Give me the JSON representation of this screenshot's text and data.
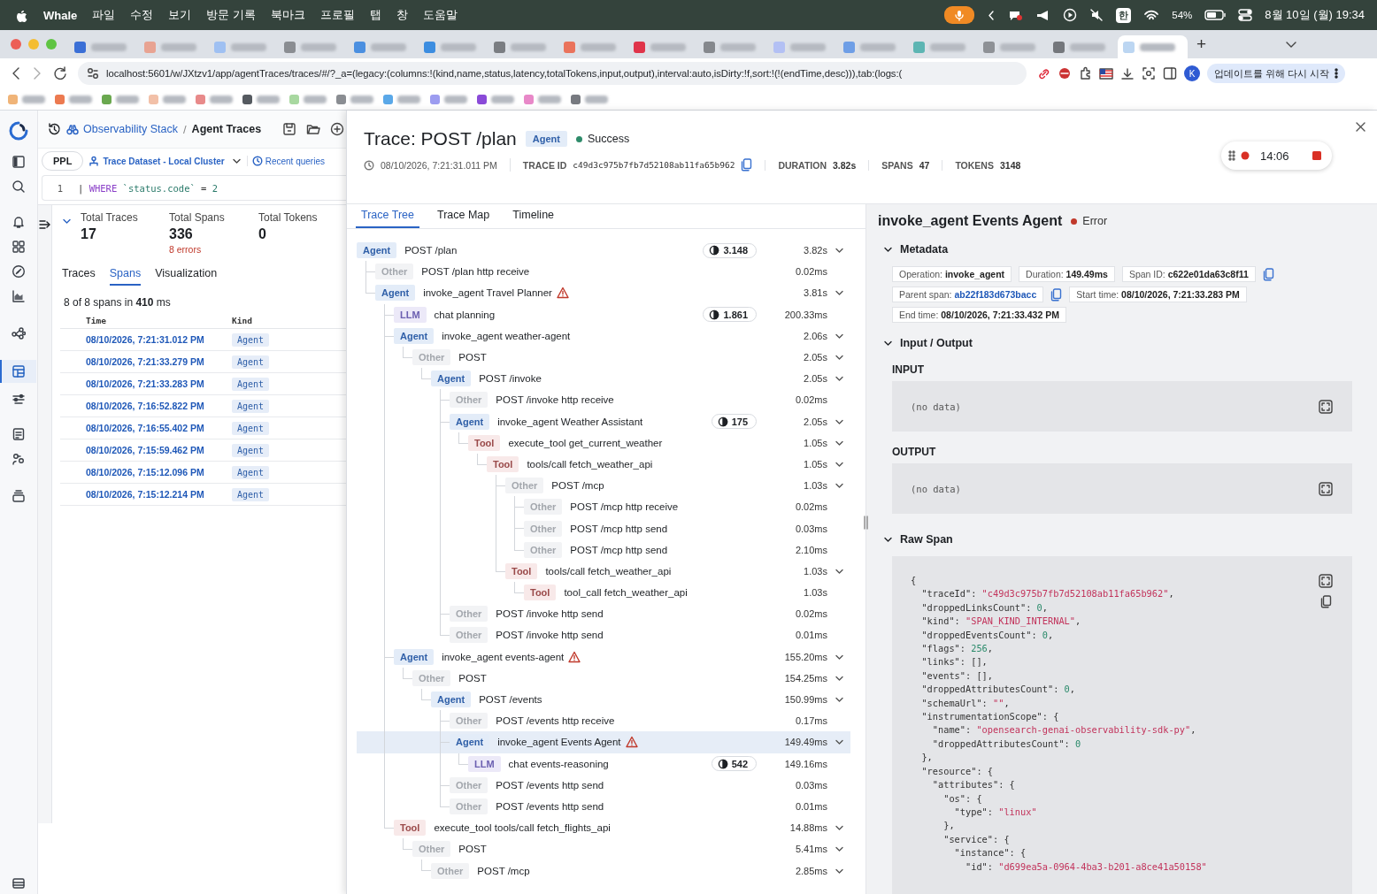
{
  "menubar": {
    "app": "Whale",
    "menus": [
      "파일",
      "수정",
      "보기",
      "방문 기록",
      "북마크",
      "프로필",
      "탭",
      "창",
      "도움말"
    ],
    "input_source": "한",
    "battery": "54%",
    "clock": "8월 10일 (월) 19:34"
  },
  "browser": {
    "tabs": [
      {
        "color": "#3b6fd6",
        "selected": false
      },
      {
        "color": "#e8a392",
        "selected": false
      },
      {
        "color": "#9fc0f2",
        "selected": false
      },
      {
        "color": "#8a8d92",
        "selected": false
      },
      {
        "color": "#4b8fe0",
        "selected": false
      },
      {
        "color": "#3c8de0",
        "selected": false
      },
      {
        "color": "#7a7d82",
        "selected": false
      },
      {
        "color": "#ea735c",
        "selected": false
      },
      {
        "color": "#e0344a",
        "selected": false
      },
      {
        "color": "#85888d",
        "selected": false
      },
      {
        "color": "#b3c0f4",
        "selected": false
      },
      {
        "color": "#6e9ee6",
        "selected": false
      },
      {
        "color": "#5db5b3",
        "selected": false
      },
      {
        "color": "#8e9196",
        "selected": false
      },
      {
        "color": "#74777c",
        "selected": false
      },
      {
        "color": "#bcd6f2",
        "selected": true
      }
    ],
    "new_tab": "+",
    "url": "localhost:5601/w/JXtzv1/app/agentTraces/traces/#/?_a=(legacy:(columns:!(kind,name,status,latency,totalTokens,input,output),interval:auto,isDirty:!f,sort:!(!(endTime,desc))),tab:(logs:(",
    "profile": "K",
    "update_button": "업데이트를 위해 다시 시작",
    "bookmarks": [
      {
        "color": "#f0b478"
      },
      {
        "color": "#ec7a50"
      },
      {
        "color": "#6aa84f"
      },
      {
        "color": "#f2c0a8"
      },
      {
        "color": "#e88a8a"
      },
      {
        "color": "#555a60"
      },
      {
        "color": "#a8d8a0"
      },
      {
        "color": "#8a8d92"
      },
      {
        "color": "#5aa8e8"
      },
      {
        "color": "#9c9cf0"
      },
      {
        "color": "#8a4ad8"
      },
      {
        "color": "#e888c8"
      },
      {
        "color": "#777a80"
      }
    ]
  },
  "nav": [
    {
      "selected": false
    },
    {
      "selected": false
    },
    {
      "selected": false
    },
    {
      "selected": false
    },
    {
      "selected": false
    },
    {
      "selected": false
    },
    {
      "selected": false
    },
    {
      "selected": true
    },
    {
      "selected": false
    },
    {
      "selected": false
    },
    {
      "selected": false
    },
    {
      "selected": false
    },
    {
      "selected": false
    }
  ],
  "explorer": {
    "breadcrumb": [
      "Observability Stack",
      "Agent Traces"
    ],
    "separator": "/",
    "language": "PPL",
    "dataset": "Trace Dataset - Local Cluster",
    "recent": "Recent queries",
    "query": {
      "line": "1",
      "pipe": "|",
      "keyword": "WHERE",
      "field": "`status.code`",
      "operator": "=",
      "value": "2"
    },
    "stats": [
      {
        "label": "Total Traces",
        "value": "17"
      },
      {
        "label": "Total Spans",
        "value": "336",
        "note": "8 errors"
      },
      {
        "label": "Total Tokens",
        "value": "0"
      }
    ],
    "tabs": [
      {
        "label": "Traces",
        "selected": false
      },
      {
        "label": "Spans",
        "selected": true
      },
      {
        "label": "Visualization",
        "selected": false
      }
    ],
    "summary": "8 of 8 spans in **410** ms",
    "columns": [
      "Time",
      "Kind"
    ],
    "rows": [
      {
        "time": "08/10/2026, 7:21:31.012 PM",
        "kind": "Agent"
      },
      {
        "time": "08/10/2026, 7:21:33.279 PM",
        "kind": "Agent"
      },
      {
        "time": "08/10/2026, 7:21:33.283 PM",
        "kind": "Agent"
      },
      {
        "time": "08/10/2026, 7:16:52.822 PM",
        "kind": "Agent"
      },
      {
        "time": "08/10/2026, 7:16:55.402 PM",
        "kind": "Agent"
      },
      {
        "time": "08/10/2026, 7:15:59.462 PM",
        "kind": "Agent"
      },
      {
        "time": "08/10/2026, 7:15:12.096 PM",
        "kind": "Agent"
      },
      {
        "time": "08/10/2026, 7:15:12.214 PM",
        "kind": "Agent"
      }
    ]
  },
  "trace": {
    "title": "Trace: POST /plan",
    "kind": "Agent",
    "status": {
      "label": "Success",
      "ok": true
    },
    "timestamp": "08/10/2026, 7:21:31.011 PM",
    "meta": [
      {
        "label": "TRACE ID",
        "value": "c49d3c975b7fb7d52108ab11fa65b962",
        "copy": true
      },
      {
        "label": "DURATION",
        "value": "3.82s",
        "copy": false
      },
      {
        "label": "SPANS",
        "value": "47",
        "copy": false
      },
      {
        "label": "TOKENS",
        "value": "3148",
        "copy": false
      }
    ],
    "recorder": {
      "time": "14:06"
    },
    "tabs": [
      {
        "label": "Trace Tree",
        "selected": true
      },
      {
        "label": "Trace Map",
        "selected": false
      },
      {
        "label": "Timeline",
        "selected": false
      }
    ],
    "tree": [
      {
        "kind": "agent",
        "badge": "Agent",
        "name": "POST /plan",
        "tokens": "3.148",
        "duration": "3.82s",
        "error": false,
        "selected": false,
        "expanded": true,
        "children": [
          {
            "kind": "other",
            "badge": "Other",
            "name": "POST /plan http receive",
            "duration": "0.02ms",
            "error": false,
            "selected": false
          },
          {
            "kind": "agent",
            "badge": "Agent",
            "name": "invoke_agent Travel Planner",
            "duration": "3.81s",
            "error": true,
            "selected": false,
            "expanded": true,
            "children": [
              {
                "kind": "llm",
                "badge": "LLM",
                "name": "chat planning",
                "tokens": "1.861",
                "duration": "200.33ms",
                "error": false,
                "selected": false
              },
              {
                "kind": "agent",
                "badge": "Agent",
                "name": "invoke_agent weather-agent",
                "duration": "2.06s",
                "error": false,
                "selected": false,
                "expanded": true,
                "children": [
                  {
                    "kind": "other",
                    "badge": "Other",
                    "name": "POST",
                    "duration": "2.05s",
                    "error": false,
                    "selected": false,
                    "expanded": true,
                    "children": [
                      {
                        "kind": "agent",
                        "badge": "Agent",
                        "name": "POST /invoke",
                        "duration": "2.05s",
                        "error": false,
                        "selected": false,
                        "expanded": true,
                        "children": [
                          {
                            "kind": "other",
                            "badge": "Other",
                            "name": "POST /invoke http receive",
                            "duration": "0.02ms",
                            "error": false,
                            "selected": false
                          },
                          {
                            "kind": "agent",
                            "badge": "Agent",
                            "name": "invoke_agent Weather Assistant",
                            "tokens": "175",
                            "duration": "2.05s",
                            "error": false,
                            "selected": false,
                            "expanded": true,
                            "children": [
                              {
                                "kind": "tool",
                                "badge": "Tool",
                                "name": "execute_tool get_current_weather",
                                "duration": "1.05s",
                                "error": false,
                                "selected": false,
                                "expanded": true,
                                "children": [
                                  {
                                    "kind": "tool",
                                    "badge": "Tool",
                                    "name": "tools/call fetch_weather_api",
                                    "duration": "1.05s",
                                    "error": false,
                                    "selected": false,
                                    "expanded": true,
                                    "children": [
                                      {
                                        "kind": "other",
                                        "badge": "Other",
                                        "name": "POST /mcp",
                                        "duration": "1.03s",
                                        "error": false,
                                        "selected": false,
                                        "expanded": true,
                                        "children": [
                                          {
                                            "kind": "other",
                                            "badge": "Other",
                                            "name": "POST /mcp http receive",
                                            "duration": "0.02ms",
                                            "error": false,
                                            "selected": false
                                          },
                                          {
                                            "kind": "other",
                                            "badge": "Other",
                                            "name": "POST /mcp http send",
                                            "duration": "0.03ms",
                                            "error": false,
                                            "selected": false
                                          },
                                          {
                                            "kind": "other",
                                            "badge": "Other",
                                            "name": "POST /mcp http send",
                                            "duration": "2.10ms",
                                            "error": false,
                                            "selected": false
                                          }
                                        ]
                                      },
                                      {
                                        "kind": "tool",
                                        "badge": "Tool",
                                        "name": "tools/call fetch_weather_api",
                                        "duration": "1.03s",
                                        "error": false,
                                        "selected": false,
                                        "expanded": true,
                                        "children": [
                                          {
                                            "kind": "tool",
                                            "badge": "Tool",
                                            "name": "tool_call fetch_weather_api",
                                            "duration": "1.03s",
                                            "error": false,
                                            "selected": false
                                          }
                                        ]
                                      }
                                    ]
                                  }
                                ]
                              }
                            ]
                          },
                          {
                            "kind": "other",
                            "badge": "Other",
                            "name": "POST /invoke http send",
                            "duration": "0.02ms",
                            "error": false,
                            "selected": false
                          },
                          {
                            "kind": "other",
                            "badge": "Other",
                            "name": "POST /invoke http send",
                            "duration": "0.01ms",
                            "error": false,
                            "selected": false
                          }
                        ]
                      }
                    ]
                  }
                ]
              },
              {
                "kind": "agent",
                "badge": "Agent",
                "name": "invoke_agent events-agent",
                "duration": "155.20ms",
                "error": true,
                "selected": false,
                "expanded": true,
                "children": [
                  {
                    "kind": "other",
                    "badge": "Other",
                    "name": "POST",
                    "duration": "154.25ms",
                    "error": false,
                    "selected": false,
                    "expanded": true,
                    "children": [
                      {
                        "kind": "agent",
                        "badge": "Agent",
                        "name": "POST /events",
                        "duration": "150.99ms",
                        "error": false,
                        "selected": false,
                        "expanded": true,
                        "children": [
                          {
                            "kind": "other",
                            "badge": "Other",
                            "name": "POST /events http receive",
                            "duration": "0.17ms",
                            "error": false,
                            "selected": false
                          },
                          {
                            "kind": "agent",
                            "badge": "Agent",
                            "name": "invoke_agent Events Agent",
                            "duration": "149.49ms",
                            "error": true,
                            "selected": true,
                            "expanded": true,
                            "children": [
                              {
                                "kind": "llm",
                                "badge": "LLM",
                                "name": "chat events-reasoning",
                                "tokens": "542",
                                "duration": "149.16ms",
                                "error": false,
                                "selected": false
                              }
                            ]
                          },
                          {
                            "kind": "other",
                            "badge": "Other",
                            "name": "POST /events http send",
                            "duration": "0.03ms",
                            "error": false,
                            "selected": false
                          },
                          {
                            "kind": "other",
                            "badge": "Other",
                            "name": "POST /events http send",
                            "duration": "0.01ms",
                            "error": false,
                            "selected": false
                          }
                        ]
                      }
                    ]
                  }
                ]
              },
              {
                "kind": "tool",
                "badge": "Tool",
                "name": "execute_tool tools/call fetch_flights_api",
                "duration": "14.88ms",
                "error": false,
                "selected": false,
                "expanded": true,
                "children": [
                  {
                    "kind": "other",
                    "badge": "Other",
                    "name": "POST",
                    "duration": "5.41ms",
                    "error": false,
                    "selected": false,
                    "expanded": true,
                    "children": [
                      {
                        "kind": "other",
                        "badge": "Other",
                        "name": "POST /mcp",
                        "duration": "2.85ms",
                        "error": false,
                        "selected": false,
                        "expanded": true
                      }
                    ]
                  }
                ]
              }
            ]
          }
        ]
      }
    ],
    "detail": {
      "title": "invoke_agent Events Agent",
      "status": {
        "label": "Error",
        "ok": false
      },
      "metadata": {
        "heading": "Metadata",
        "expanded": true,
        "fields": [
          {
            "label": "Operation:",
            "value": "invoke_agent",
            "link": false,
            "copy": false
          },
          {
            "label": "Duration:",
            "value": "149.49ms",
            "link": false,
            "copy": false
          },
          {
            "label": "Span ID:",
            "value": "c622e01da63c8f11",
            "link": false,
            "copy": true
          },
          {
            "label": "Parent span:",
            "value": "ab22f183d673bacc",
            "link": true,
            "copy": true
          },
          {
            "label": "Start time:",
            "value": "08/10/2026, 7:21:33.283 PM",
            "link": false,
            "copy": false
          },
          {
            "label": "End time:",
            "value": "08/10/2026, 7:21:33.432 PM",
            "link": false,
            "copy": false
          }
        ]
      },
      "io": {
        "heading": "Input / Output",
        "expanded": true,
        "blocks": [
          {
            "label": "INPUT",
            "value": "(no data)"
          },
          {
            "label": "OUTPUT",
            "value": "(no data)"
          }
        ]
      },
      "raw": {
        "heading": "Raw Span",
        "expanded": true,
        "lines": [
          "{",
          "  \"traceId\": \"c49d3c975b7fb7d52108ab11fa65b962\",",
          "  \"droppedLinksCount\": 0,",
          "  \"kind\": \"SPAN_KIND_INTERNAL\",",
          "  \"droppedEventsCount\": 0,",
          "  \"flags\": 256,",
          "  \"links\": [],",
          "  \"events\": [],",
          "  \"droppedAttributesCount\": 0,",
          "  \"schemaUrl\": \"\",",
          "  \"instrumentationScope\": {",
          "    \"name\": \"opensearch-genai-observability-sdk-py\",",
          "    \"droppedAttributesCount\": 0",
          "  },",
          "  \"resource\": {",
          "    \"attributes\": {",
          "      \"os\": {",
          "        \"type\": \"linux\"",
          "      },",
          "      \"service\": {",
          "        \"instance\": {",
          "          \"id\": \"d699ea5a-0964-4ba3-b201-a8ce41a50158\""
        ]
      }
    }
  }
}
